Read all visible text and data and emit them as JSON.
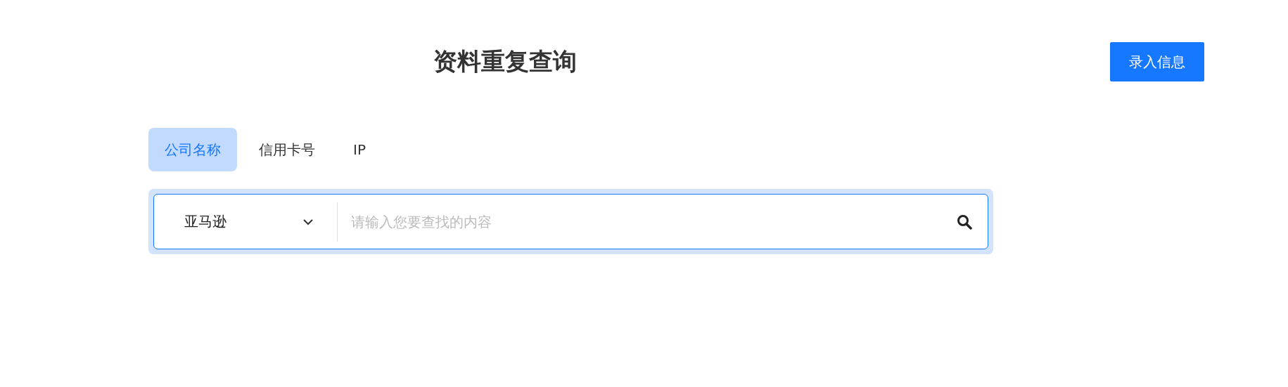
{
  "title": "资料重复查询",
  "add_button": "录入信息",
  "tabs": [
    {
      "label": "公司名称",
      "selected": true
    },
    {
      "label": "信用卡号",
      "selected": false
    },
    {
      "label": "IP",
      "selected": false
    }
  ],
  "search": {
    "dropdown": "亚马逊",
    "placeholder": "请输入您要查找的内容"
  }
}
